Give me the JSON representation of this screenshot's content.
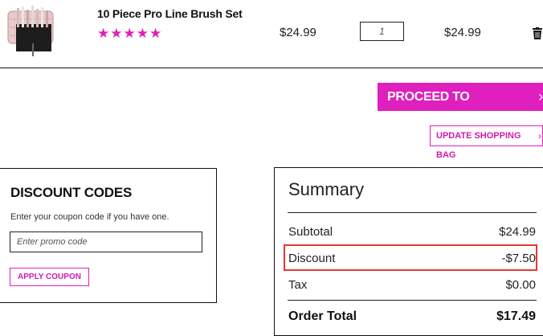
{
  "product": {
    "name": "10 Piece Pro Line Brush Set",
    "rating_stars": "★★★★★",
    "rating_value": 5,
    "price": "$24.99",
    "quantity": "1",
    "line_total": "$24.99",
    "remove_icon": "trash-icon"
  },
  "actions": {
    "checkout_label": "PROCEED TO CHECKOUT",
    "checkout_chevron": "›",
    "update_label": "UPDATE SHOPPING BAG",
    "update_chevron": "›"
  },
  "discount": {
    "title": "DISCOUNT CODES",
    "hint": "Enter your coupon code if you have one.",
    "placeholder": "Enter promo code",
    "apply_label": "APPLY COUPON"
  },
  "summary": {
    "title": "Summary",
    "rows": [
      {
        "label": "Subtotal",
        "value": "$24.99"
      },
      {
        "label": "Discount",
        "value": "-$7.50"
      },
      {
        "label": "Tax",
        "value": "$0.00"
      }
    ],
    "total_label": "Order Total",
    "total_value": "$17.49"
  },
  "colors": {
    "accent": "#e01fbf",
    "highlight": "#e53935"
  }
}
